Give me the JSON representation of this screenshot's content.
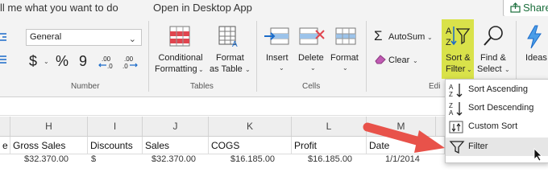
{
  "topbar": {
    "tell_me": "ll me what you want to do",
    "open_desktop": "Open in Desktop App",
    "share": "Share"
  },
  "ribbon": {
    "number_format": "General",
    "currency_symbol": "$",
    "percent_symbol": "%",
    "comma_symbol": "9",
    "conditional_formatting": [
      "Conditional",
      "Formatting"
    ],
    "format_as_table": [
      "Format",
      "as Table"
    ],
    "insert": "Insert",
    "delete": "Delete",
    "format": "Format",
    "autosum": "AutoSum",
    "clear": "Clear",
    "sort_filter": [
      "Sort &",
      "Filter"
    ],
    "find_select": [
      "Find &",
      "Select"
    ],
    "ideas": "Ideas",
    "groups": {
      "number": "Number",
      "tables": "Tables",
      "cells": "Cells",
      "editing": "Edi"
    }
  },
  "columns": [
    "H",
    "I",
    "J",
    "K",
    "L",
    "M"
  ],
  "header_row": [
    "e",
    "Gross Sales",
    "Discounts",
    "Sales",
    "COGS",
    "Profit",
    "Date"
  ],
  "partial_row": [
    "$32,370.00",
    "$",
    "$32,370.00",
    "$16,185.00",
    "$16,185.00",
    "1/1/2014"
  ],
  "menu": {
    "items": [
      "Sort Ascending",
      "Sort Descending",
      "Custom Sort",
      "Filter"
    ]
  },
  "colors": {
    "highlight": "#d9e24a",
    "arrow": "#e8524a"
  }
}
